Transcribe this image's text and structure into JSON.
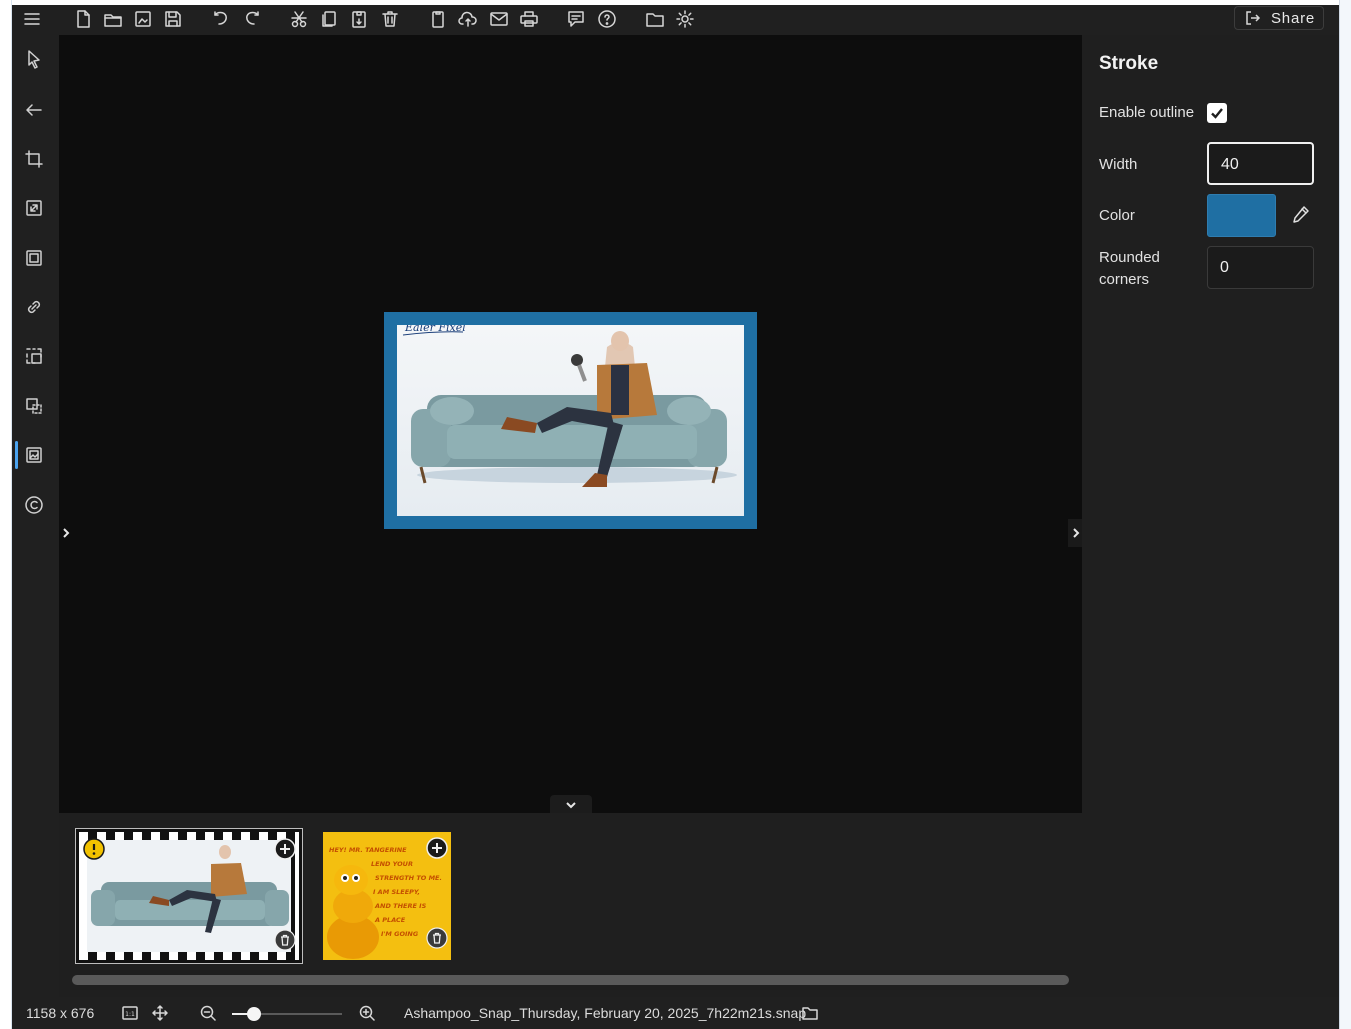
{
  "toolbar": {
    "icons": [
      "menu-icon",
      "new-file-icon",
      "open-folder-icon",
      "save-as-icon",
      "save-icon",
      "undo-icon",
      "redo-icon",
      "cut-icon",
      "copy-icon",
      "paste-icon",
      "delete-icon",
      "clipboard-icon",
      "cloud-upload-icon",
      "email-icon",
      "print-icon",
      "feedback-icon",
      "help-icon",
      "folder-icon",
      "settings-icon"
    ],
    "share_label": "Share"
  },
  "rail": {
    "tools": [
      "select-tool",
      "back",
      "crop",
      "resize",
      "frame",
      "link",
      "region-select",
      "copy-region",
      "image-border",
      "copyright"
    ],
    "active": "image-border"
  },
  "panel": {
    "title": "Stroke",
    "enable_outline_label": "Enable outline",
    "enable_outline_checked": true,
    "width_label": "Width",
    "width_value": "40",
    "color_label": "Color",
    "color_value": "#1f6fa3",
    "rounded_label": "Rounded corners",
    "rounded_value": "0"
  },
  "canvas": {
    "handwriting": "Ealer Fixel",
    "outline_color": "#1f6fa3"
  },
  "filmstrip": {
    "items": [
      {
        "kind": "sofa-photo",
        "selected": true,
        "warning": true
      },
      {
        "kind": "tangerine-poster",
        "selected": false,
        "text_lines": [
          "HEY! MR. TANGERINE",
          "LEND YOUR",
          "STRENGTH TO ME.",
          "I AM SLEEPY,",
          "AND THERE IS",
          "A PLACE",
          "I'M GOING"
        ]
      }
    ],
    "scroll_fraction": 1.0
  },
  "status": {
    "dimensions": "1158 x 676",
    "actual_size_label": "1:1",
    "filename": "Ashampoo_Snap_Thursday, February 20, 2025_7h22m21s.snap",
    "zoom_fraction": 0.2
  }
}
